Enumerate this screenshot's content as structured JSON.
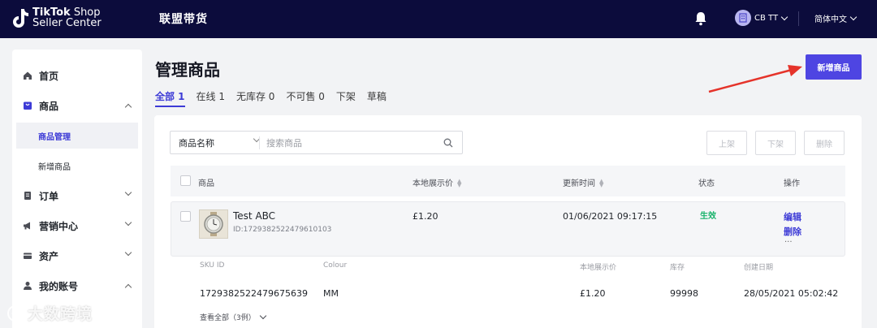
{
  "topbar": {
    "logo_line1_bold": "TikTok",
    "logo_line1_rest": " Shop",
    "logo_line2": "Seller Center",
    "nav_title": "联盟带货",
    "user_name": "CB TT",
    "language": "简体中文"
  },
  "sidebar": {
    "items": [
      {
        "label": "首页",
        "icon": "home-icon"
      },
      {
        "label": "商品",
        "icon": "product-icon"
      },
      {
        "label": "商品管理"
      },
      {
        "label": "新增商品"
      },
      {
        "label": "订单",
        "icon": "order-icon"
      },
      {
        "label": "营销中心",
        "icon": "marketing-icon"
      },
      {
        "label": "资产",
        "icon": "wallet-icon"
      },
      {
        "label": "我的账号",
        "icon": "user-icon"
      }
    ]
  },
  "main": {
    "title": "管理商品",
    "add_button": "新增商品",
    "tabs": [
      {
        "label": "全部 1"
      },
      {
        "label": "在线 1"
      },
      {
        "label": "无库存 0"
      },
      {
        "label": "不可售 0"
      },
      {
        "label": "下架"
      },
      {
        "label": "草稿"
      }
    ],
    "search": {
      "select_value": "商品名称",
      "placeholder": "搜索商品"
    },
    "actions": {
      "list": "上架",
      "delist": "下架",
      "delete": "删除"
    },
    "table": {
      "headers": {
        "product": "商品",
        "price": "本地展示价",
        "updated": "更新时间",
        "status": "状态",
        "ops": "操作"
      },
      "row": {
        "name": "Test ABC",
        "id": "ID:1729382522479610103",
        "price": "£1.20",
        "updated": "01/06/2021 09:17:15",
        "status": "生效",
        "edit": "编辑",
        "delete": "删除",
        "more": "..."
      },
      "sku": {
        "headers": {
          "sku_id": "SKU ID",
          "colour": "Colour",
          "price": "本地展示价",
          "stock": "库存",
          "created": "创建日期"
        },
        "values": {
          "sku_id": "1729382522479675639",
          "colour": "MM",
          "price": "£1.20",
          "stock": "99998",
          "created": "28/05/2021 05:02:42"
        },
        "view_all": "查看全部（3例）"
      }
    }
  },
  "watermark": "大数跨境",
  "colors": {
    "topbar": "#0c0c3c",
    "accent": "#4e45e2",
    "status_green": "#17b26a",
    "annotation_red": "#e5332a"
  }
}
